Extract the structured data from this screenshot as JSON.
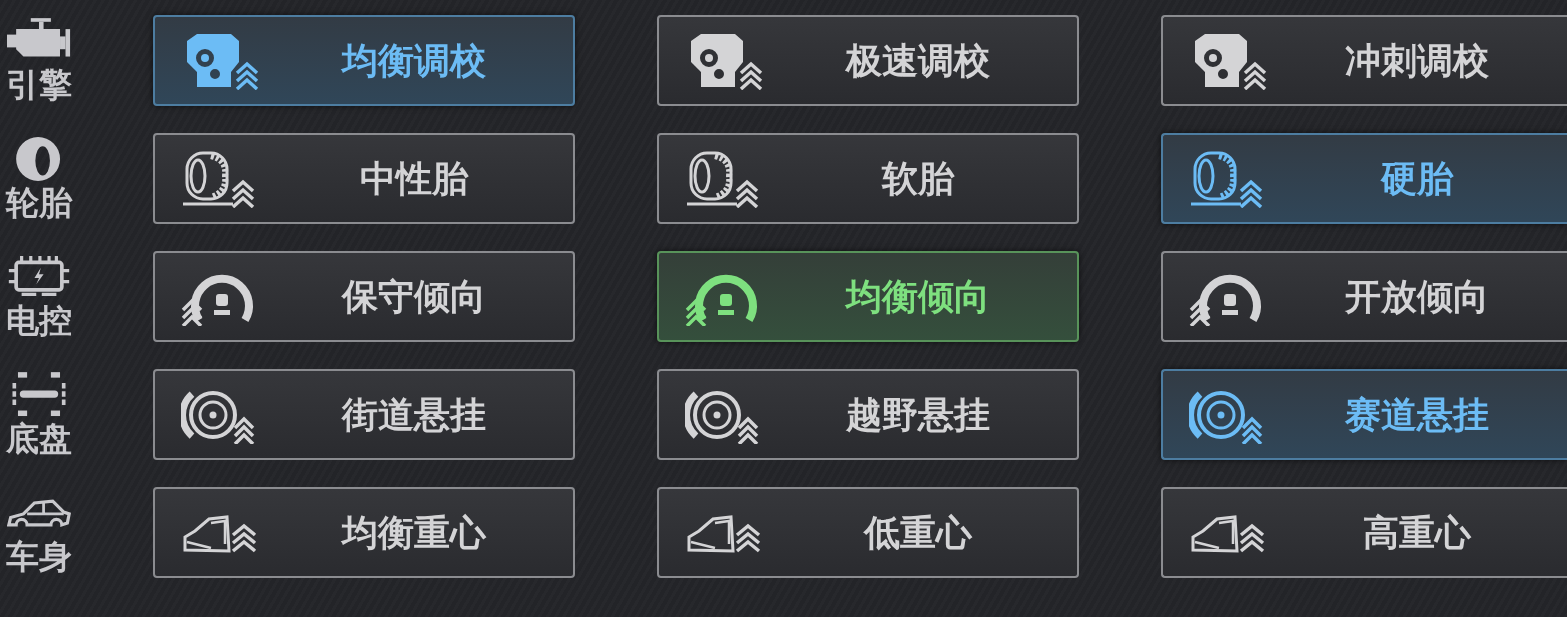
{
  "categories": [
    {
      "kind": "engine",
      "label": "引擎",
      "options": [
        {
          "label": "均衡调校",
          "selected": true,
          "color": "#6cbcf5"
        },
        {
          "label": "极速调校",
          "selected": false
        },
        {
          "label": "冲刺调校",
          "selected": false
        }
      ]
    },
    {
      "kind": "tire",
      "label": "轮胎",
      "options": [
        {
          "label": "中性胎",
          "selected": false
        },
        {
          "label": "软胎",
          "selected": false
        },
        {
          "label": "硬胎",
          "selected": true,
          "color": "#6cbcf5"
        }
      ]
    },
    {
      "kind": "electronics",
      "label": "电控",
      "options": [
        {
          "label": "保守倾向",
          "selected": false
        },
        {
          "label": "均衡倾向",
          "selected": true,
          "color": "#7ee07f"
        },
        {
          "label": "开放倾向",
          "selected": false
        }
      ]
    },
    {
      "kind": "chassis",
      "label": "底盘",
      "options": [
        {
          "label": "街道悬挂",
          "selected": false
        },
        {
          "label": "越野悬挂",
          "selected": false
        },
        {
          "label": "赛道悬挂",
          "selected": true,
          "color": "#6cbcf5"
        }
      ]
    },
    {
      "kind": "body",
      "label": "车身",
      "options": [
        {
          "label": "均衡重心",
          "selected": false
        },
        {
          "label": "低重心",
          "selected": false
        },
        {
          "label": "高重心",
          "selected": false
        }
      ]
    }
  ]
}
